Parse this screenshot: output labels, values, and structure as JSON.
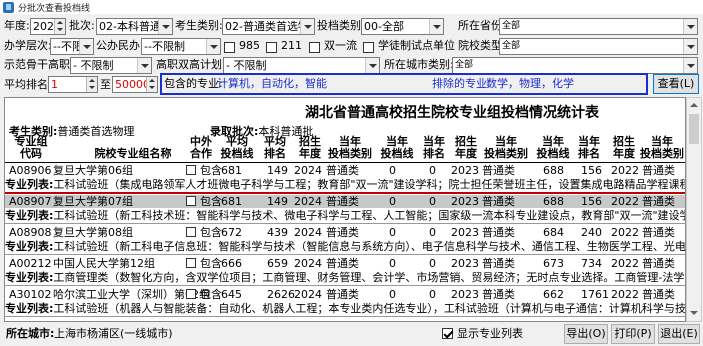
{
  "window": {
    "title": "分批次查看投档线"
  },
  "filters": {
    "year_label": "年度:",
    "year_value": "2024",
    "batch_label": "批次:",
    "batch_value": "02-本科普通批",
    "student_type_label": "考生类别:",
    "student_type_value": "02-普通类首选物理",
    "cast_type_label": "投档类别:",
    "cast_type_value": "00-全部",
    "province_label": "所在省份:",
    "province_value": "全部",
    "school_level_label": "办学层次:",
    "school_level_value": "--不限制",
    "public_private_label": "公办民办:",
    "public_private_value": "--不限制",
    "cb_985": "985",
    "cb_211": "211",
    "cb_double": "双一流",
    "cb_pilot": "学徒制试点单位",
    "school_type_label": "院校类型:",
    "school_type_value": "全部",
    "demo_label": "示范骨干高职:",
    "demo_value": "- 不限制",
    "double_high_label": "高职双高计划:",
    "double_high_value": "- 不限制",
    "city_type_label": "所在城市类别:",
    "city_type_value": "全部",
    "rank_label": "平均排名:",
    "rank_from": "1",
    "rank_to_label": "至",
    "rank_to": "500000",
    "include_label": "包含的专业:",
    "include_value": "计算机，自动化，智能",
    "exclude_label": "排除的专业:",
    "exclude_value": "数学，物理，化学",
    "query_button": "查看(L)"
  },
  "report": {
    "title": "湖北省普通高校招生院校专业组投档情况统计表",
    "student_type_label": "考生类别:",
    "student_type_value": "普通类首选物理",
    "batch_label": "录取批次:",
    "batch_value": "本科普通批",
    "headers": {
      "code": [
        "专业组",
        "代码"
      ],
      "name": "院校专业组名称",
      "coop": [
        "中外",
        "合作"
      ],
      "avg_line": [
        "平均",
        "投档线"
      ],
      "avg_rank": [
        "平均",
        "排名"
      ],
      "year1": [
        "招生",
        "年度"
      ],
      "type1": [
        "当年",
        "投档类别"
      ],
      "line1": [
        "当年",
        "投档线"
      ],
      "rank1": [
        "当年",
        "排名"
      ],
      "year2": [
        "招生",
        "年度"
      ],
      "type2": [
        "当年",
        "投档类别"
      ],
      "line2": [
        "当年",
        "投档线"
      ],
      "rank2": [
        "当年",
        "排名"
      ],
      "year3": [
        "招生",
        "年度"
      ],
      "type3": [
        "当年",
        "投档类别"
      ]
    },
    "rows": [
      {
        "code": "A08906",
        "name": "复旦大学第06组",
        "coop": "包含",
        "avg_line": "681",
        "avg_rank": "149",
        "y1": "2024",
        "t1": "普通类",
        "l1": "0",
        "r1": "0",
        "y2": "2023",
        "t2": "普通类",
        "l2": "688",
        "r2": "156",
        "y3": "2022",
        "t3": "普通类",
        "detail_label": "专业列表:",
        "detail": "工科试验班（集成电路领军人才班微电子科学与工程；教育部\"双一流\"建设学科；院士担任荣誉班主任，设置集成电路精品学程课程，计算机、人工智能"
      },
      {
        "code": "A08907",
        "name": "复旦大学第07组",
        "coop": "包含",
        "avg_line": "681",
        "avg_rank": "149",
        "y1": "2024",
        "t1": "普通类",
        "l1": "0",
        "r1": "0",
        "y2": "2023",
        "t2": "普通类",
        "l2": "688",
        "r2": "156",
        "y3": "2022",
        "t3": "普通类",
        "detail_label": "专业列表:",
        "detail": "工科试验班（新工科技术班：智能科学与技术、微电子科学与工程、人工智能；国家级一流本科专业建设点，教育部\"双一流\"建设学科；含加拿大多伦多"
      },
      {
        "code": "A08908",
        "name": "复旦大学第08组",
        "coop": "包含",
        "avg_line": "672",
        "avg_rank": "439",
        "y1": "2024",
        "t1": "普通类",
        "l1": "0",
        "r1": "0",
        "y2": "2023",
        "t2": "普通类",
        "l2": "684",
        "r2": "240",
        "y3": "2022",
        "t3": "普通类",
        "detail_label": "专业列表:",
        "detail": "工科试验班（新工科电子信息班：智能科学与技术（智能信息与系统方向）、电子信息科学与技术、通信工程、生物医学工程、光电信息科学与工程；国"
      },
      {
        "code": "A00212",
        "name": "中国人民大学第12组",
        "coop": "包含",
        "avg_line": "666",
        "avg_rank": "659",
        "y1": "2024",
        "t1": "普通类",
        "l1": "0",
        "r1": "0",
        "y2": "2023",
        "t2": "普通类",
        "l2": "673",
        "r2": "734",
        "y3": "2022",
        "t3": "普通类",
        "detail_label": "专业列表:",
        "detail": "工商管理类（数智化方向，含双学位项目；工商管理、财务管理、会计学、市场营销、贸易经济；无时点专业选择。工商管理-法学、营销管理-数据科学"
      },
      {
        "code": "A30102",
        "name": "哈尔滨工业大学（深圳）第02组",
        "coop": "包含",
        "avg_line": "645",
        "avg_rank": "2626",
        "y1": "2024",
        "t1": "普通类",
        "l1": "0",
        "r1": "0",
        "y2": "2023",
        "t2": "普通类",
        "l2": "662",
        "r2": "1761",
        "y3": "2022",
        "t3": "普通类",
        "detail_label": "专业列表:",
        "detail": "工科试验班（机器人与智能装备：自动化、机器人工程；本专业类内任选专业），工科试验班（计算机与电子通信：计算机科学与技术、数据科学与大数"
      }
    ]
  },
  "footer": {
    "city_label": "所在城市:",
    "city_value": "上海市杨浦区(一线城市)",
    "show_list_label": "显示专业列表",
    "export_button": "导出(O)",
    "print_button": "打印(P)",
    "exit_button": "退出(E)"
  },
  "colors": {
    "rank_red": "#e00000",
    "include_blue": "#1a2fd0",
    "divider_red": "#c00000"
  }
}
